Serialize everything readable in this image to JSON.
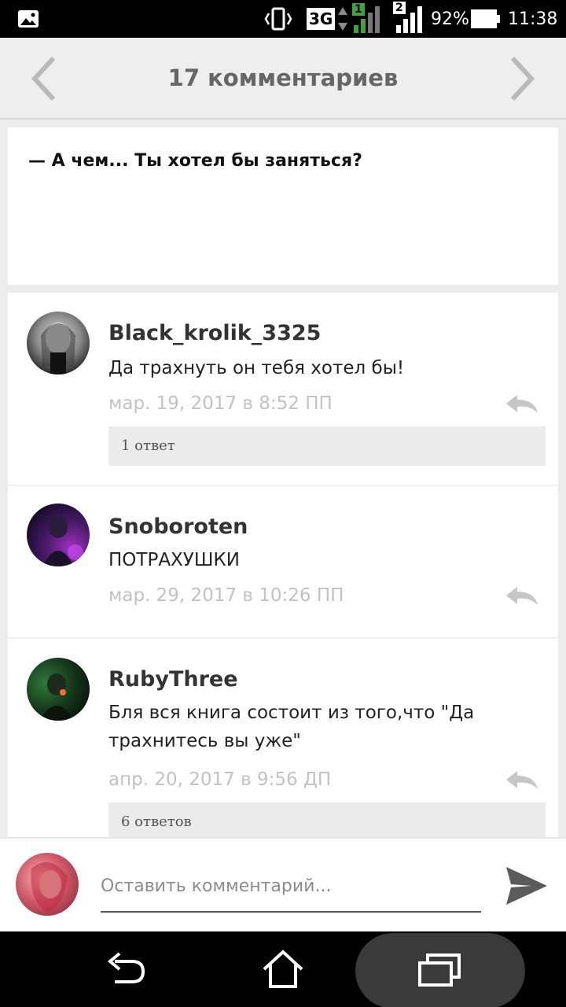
{
  "status_bar": {
    "network": "3G",
    "sim1": "1",
    "sim2": "2",
    "battery": "92%",
    "time": "11:38"
  },
  "header": {
    "title": "17 комментариев",
    "prev_icon": "chevron-left-icon",
    "next_icon": "chevron-right-icon"
  },
  "quote": {
    "text": "— А чем... Ты хотел бы заняться?"
  },
  "comments": [
    {
      "author": "Black_krolik_3325",
      "text": "Да трахнуть он тебя хотел бы!",
      "date": "мар. 19, 2017 в 8:52 ПП",
      "replies": "1 ответ"
    },
    {
      "author": "Snoboroten",
      "text": "ПОТРАХУШКИ",
      "date": "мар. 29, 2017 в 10:26 ПП",
      "replies": ""
    },
    {
      "author": "RubyThree",
      "text": "Бля вся книга состоит из того,что \"Да трахнитесь вы уже\"",
      "date": "апр. 20, 2017 в 9:56 ДП",
      "replies": "6 ответов"
    }
  ],
  "compose": {
    "placeholder": "Оставить комментарий...",
    "send_icon": "send-icon"
  },
  "colors": {
    "header_bg": "#eeeeee",
    "date": "#c2c2c2",
    "replies_bg": "#ebebeb"
  }
}
